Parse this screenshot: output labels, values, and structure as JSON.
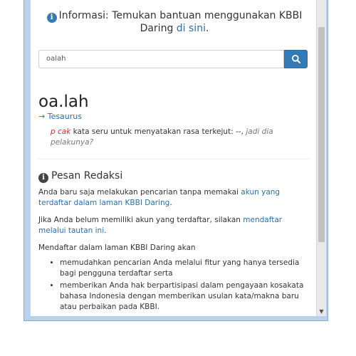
{
  "info": {
    "prefix": "Informasi: Temukan bantuan menggunakan KBBI Daring ",
    "link": "di sini",
    "suffix": "."
  },
  "search": {
    "value": "oalah"
  },
  "entry": {
    "headword": "oa.lah",
    "tesaurus": "→ Tesaurus",
    "abbr": "p cak",
    "definition": " kata seru untuk menyatakan rasa terkejut: --, ",
    "example": "jadi dia pelakunya?"
  },
  "pesan": {
    "title": "Pesan Redaksi",
    "p1_text": "Anda baru saja melakukan pencarian tanpa memakai ",
    "p1_link": "akun yang terdaftar dalam laman KBBI Daring",
    "p1_end": ".",
    "p2_text": "Jika Anda belum memiliki akun yang terdaftar, silakan ",
    "p2_link": "mendaftar melalui tautan ini",
    "p2_end": ".",
    "p3": "Mendaftar dalam laman KBBI Daring akan",
    "bullets": [
      "memudahkan pencarian Anda melalui fitur yang hanya tersedia bagi pengguna terdaftar serta",
      "memberikan Anda hak berpartisipasi dalam pengayaan kosakata bahasa Indonesia dengan memberikan usulan kata/makna baru atau perbaikan pada KBBI."
    ]
  },
  "icons": {
    "info": "info-circle-icon",
    "search": "search-icon",
    "scroll_down": "chevron-down-icon"
  },
  "colors": {
    "accent": "#337ab7",
    "link": "#2a6fb0",
    "abbr": "#c9302c"
  }
}
